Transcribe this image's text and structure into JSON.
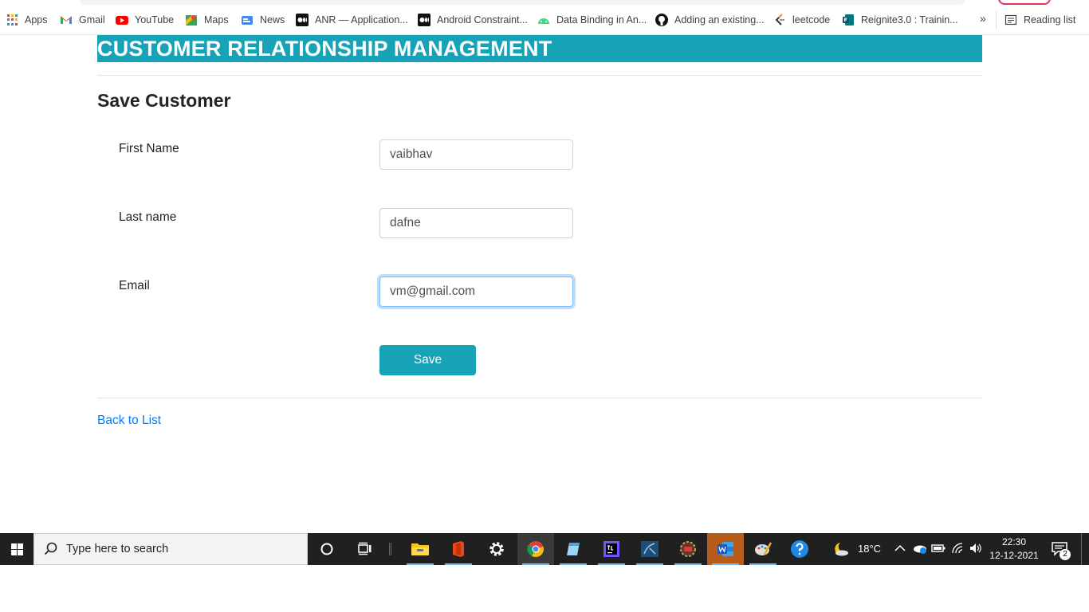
{
  "bookmarks": {
    "apps": "Apps",
    "items": [
      {
        "label": "Gmail",
        "icon": "gmail-icon"
      },
      {
        "label": "YouTube",
        "icon": "youtube-icon"
      },
      {
        "label": "Maps",
        "icon": "maps-icon"
      },
      {
        "label": "News",
        "icon": "news-icon"
      },
      {
        "label": "ANR — Application...",
        "icon": "medium-icon"
      },
      {
        "label": "Android Constraint...",
        "icon": "medium-icon"
      },
      {
        "label": "Data Binding in An...",
        "icon": "android-icon"
      },
      {
        "label": "Adding an existing...",
        "icon": "github-icon"
      },
      {
        "label": "leetcode",
        "icon": "leetcode-icon"
      },
      {
        "label": "Reignite3.0 : Trainin...",
        "icon": "forms-icon"
      }
    ],
    "more": "»",
    "reading_list": "Reading list"
  },
  "header": {
    "title": "CUSTOMER RELATIONSHIP MANAGEMENT"
  },
  "page": {
    "title": "Save Customer"
  },
  "form": {
    "first_name": {
      "label": "First Name",
      "value": "vaibhav"
    },
    "last_name": {
      "label": "Last name",
      "value": "dafne"
    },
    "email": {
      "label": "Email",
      "value": "vm@gmail.com"
    },
    "save_label": "Save"
  },
  "back_link": "Back to List",
  "taskbar": {
    "search_placeholder": "Type here to search",
    "temperature": "18°C",
    "time": "22:30",
    "date": "12-12-2021",
    "notification_count": "2"
  },
  "colors": {
    "accent": "#17a2b8",
    "link": "#007bff",
    "taskbar": "#202020"
  }
}
